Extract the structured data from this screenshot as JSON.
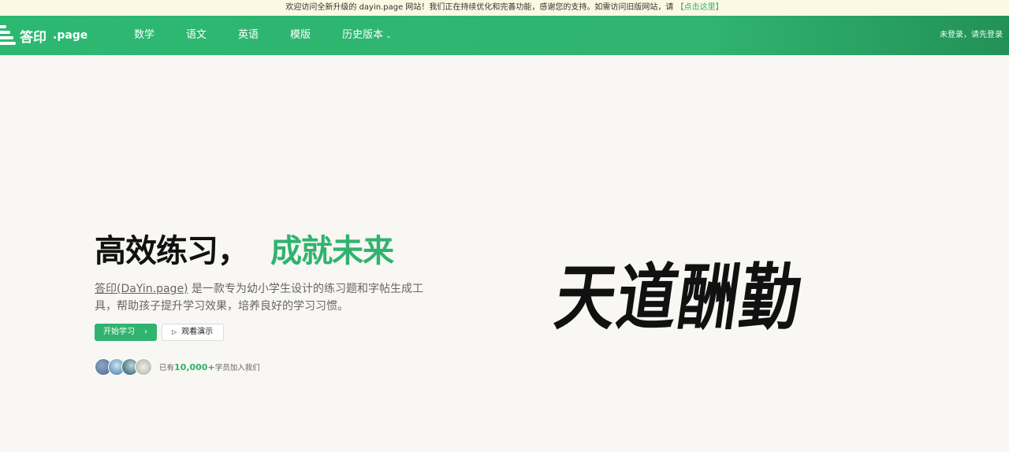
{
  "announcement": {
    "text": "欢迎访问全新升级的 dayin.page 网站！我们正在持续优化和完善功能，感谢您的支持。如需访问旧版网站，请",
    "link": "【点击这里】"
  },
  "logo": {
    "name": "答印",
    "suffix": ".page"
  },
  "nav": {
    "items": [
      "数学",
      "语文",
      "英语",
      "模版"
    ],
    "history": "历史版本"
  },
  "login_status": "未登录，请先登录",
  "hero": {
    "title_black": "高效练习，",
    "title_green": "成就未来",
    "brand_link": "答印(DaYin.page)",
    "description": "是一款专为幼小学生设计的练习题和字帖生成工具，帮助孩子提升学习效果，培养良好的学习习惯。",
    "start_button": "开始学习",
    "demo_button": "观看演示",
    "join_prefix": "已有",
    "join_count": "10,000+",
    "join_suffix": "学员加入我们"
  },
  "calligraphy": {
    "text": "天道酬勤"
  },
  "colors": {
    "brand_green": "#2fb36e",
    "announce_bg": "#fdf8e2",
    "page_bg": "#f8f7f3"
  },
  "icons": [
    "logo-mark-icon",
    "chevron-down-icon",
    "chevron-right-icon",
    "play-icon"
  ]
}
